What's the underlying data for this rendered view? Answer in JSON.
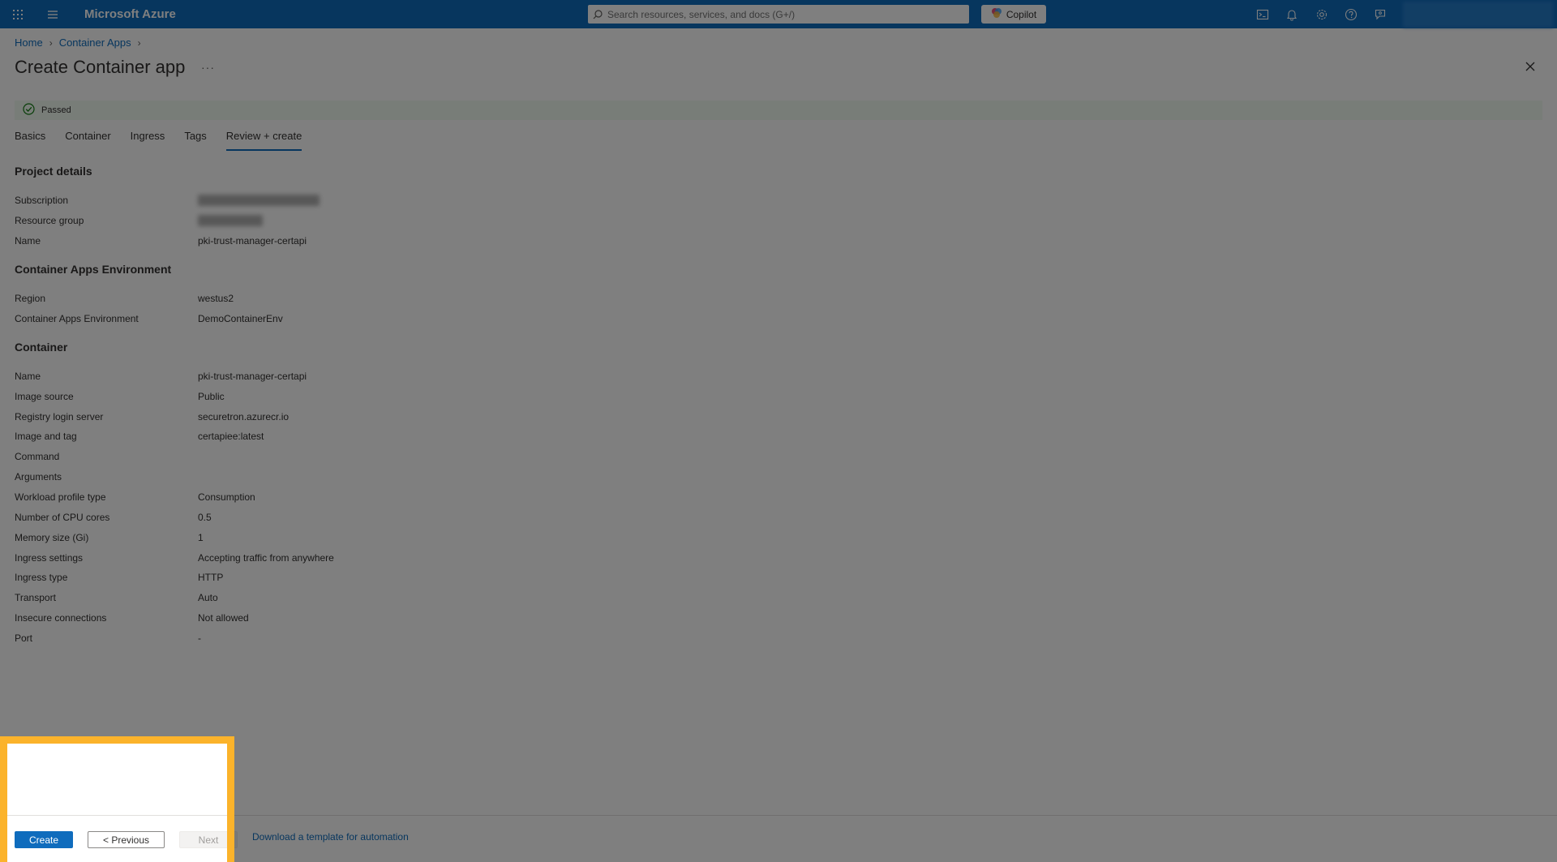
{
  "topbar": {
    "brand": "Microsoft Azure",
    "search_placeholder": "Search resources, services, and docs (G+/)",
    "copilot_label": "Copilot",
    "icons": [
      "waffle-icon",
      "hamburger-icon",
      "cloud-shell-icon",
      "bell-icon",
      "gear-icon",
      "help-icon",
      "feedback-icon"
    ]
  },
  "breadcrumb": {
    "items": [
      "Home",
      "Container Apps"
    ]
  },
  "page": {
    "title": "Create Container app",
    "more": "···"
  },
  "validation": {
    "status": "Passed"
  },
  "tabs": [
    "Basics",
    "Container",
    "Ingress",
    "Tags",
    "Review + create"
  ],
  "active_tab": "Review + create",
  "sections": {
    "project": {
      "title": "Project details",
      "subscription_label": "Subscription",
      "resource_group_label": "Resource group",
      "name_label": "Name",
      "name_value": "pki-trust-manager-certapi"
    },
    "environment": {
      "title": "Container Apps Environment",
      "region_label": "Region",
      "region_value": "westus2",
      "env_label": "Container Apps Environment",
      "env_value": "DemoContainerEnv"
    },
    "container": {
      "title": "Container",
      "rows": [
        {
          "label": "Name",
          "value": "pki-trust-manager-certapi"
        },
        {
          "label": "Image source",
          "value": "Public"
        },
        {
          "label": "Registry login server",
          "value": "securetron.azurecr.io"
        },
        {
          "label": "Image and tag",
          "value": "certapiee:latest"
        },
        {
          "label": "Command",
          "value": ""
        },
        {
          "label": "Arguments",
          "value": ""
        },
        {
          "label": "Workload profile type",
          "value": "Consumption"
        },
        {
          "label": "Number of CPU cores",
          "value": "0.5"
        },
        {
          "label": "Memory size (Gi)",
          "value": "1"
        },
        {
          "label": "Ingress settings",
          "value": "Accepting traffic from anywhere"
        },
        {
          "label": "Ingress type",
          "value": "HTTP"
        },
        {
          "label": "Transport",
          "value": "Auto"
        },
        {
          "label": "Insecure connections",
          "value": "Not allowed"
        },
        {
          "label": "Port",
          "value": "-"
        }
      ]
    }
  },
  "footer": {
    "create_label": "Create",
    "previous_label": "< Previous",
    "next_label": "Next",
    "download_label": "Download a template for automation"
  },
  "colors": {
    "accent": "#0f6cbd",
    "highlight": "#fbb32b",
    "success": "#107c10"
  }
}
